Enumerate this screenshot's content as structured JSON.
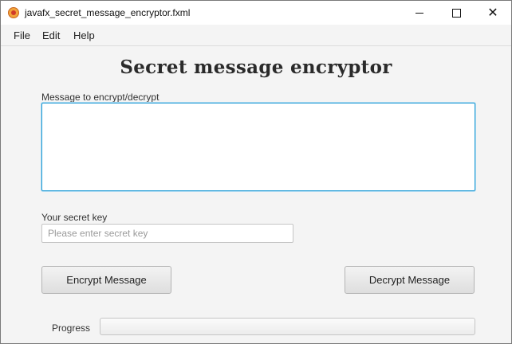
{
  "window": {
    "title": "javafx_secret_message_encryptor.fxml",
    "controls": {
      "minimize": "minimize-icon",
      "maximize": "maximize-icon",
      "close": "✕"
    }
  },
  "menu": {
    "items": [
      "File",
      "Edit",
      "Help"
    ]
  },
  "main": {
    "heading": "Secret message encryptor",
    "message_label": "Message to encrypt/decrypt",
    "message_value": "",
    "key_label": "Your secret key",
    "key_value": "",
    "key_placeholder": "Please enter secret key",
    "encrypt_label": "Encrypt Message",
    "decrypt_label": "Decrypt Message",
    "progress_label": "Progress",
    "progress_value": 0
  },
  "colors": {
    "focus_border": "#2a9fd6",
    "background": "#f4f4f4"
  }
}
